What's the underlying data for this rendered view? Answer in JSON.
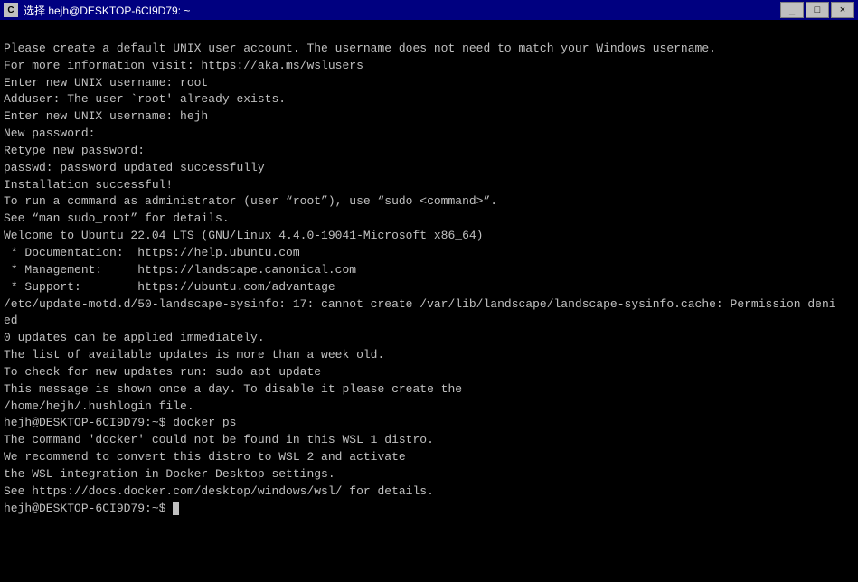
{
  "titleBar": {
    "icon": "C",
    "text": "选择 hejh@DESKTOP-6CI9D79: ~",
    "minimizeLabel": "_",
    "maximizeLabel": "□",
    "closeLabel": "×"
  },
  "terminal": {
    "lines": [
      "Please create a default UNIX user account. The username does not need to match your Windows username.",
      "For more information visit: https://aka.ms/wslusers",
      "Enter new UNIX username: root",
      "Adduser: The user `root' already exists.",
      "Enter new UNIX username: hejh",
      "New password:",
      "Retype new password:",
      "passwd: password updated successfully",
      "Installation successful!",
      "To run a command as administrator (user “root”), use “sudo <command>”.",
      "See “man sudo_root” for details.",
      "",
      "Welcome to Ubuntu 22.04 LTS (GNU/Linux 4.4.0-19041-Microsoft x86_64)",
      "",
      " * Documentation:  https://help.ubuntu.com",
      " * Management:     https://landscape.canonical.com",
      " * Support:        https://ubuntu.com/advantage",
      "/etc/update-motd.d/50-landscape-sysinfo: 17: cannot create /var/lib/landscape/landscape-sysinfo.cache: Permission deni",
      "ed",
      "",
      "0 updates can be applied immediately.",
      "",
      "",
      "The list of available updates is more than a week old.",
      "To check for new updates run: sudo apt update",
      "",
      "",
      "This message is shown once a day. To disable it please create the",
      "/home/hejh/.hushlogin file.",
      "hejh@DESKTOP-6CI9D79:~$ docker ps",
      "",
      "The command 'docker' could not be found in this WSL 1 distro.",
      "We recommend to convert this distro to WSL 2 and activate",
      "the WSL integration in Docker Desktop settings.",
      "",
      "See https://docs.docker.com/desktop/windows/wsl/ for details.",
      "",
      "hejh@DESKTOP-6CI9D79:~$ "
    ]
  }
}
